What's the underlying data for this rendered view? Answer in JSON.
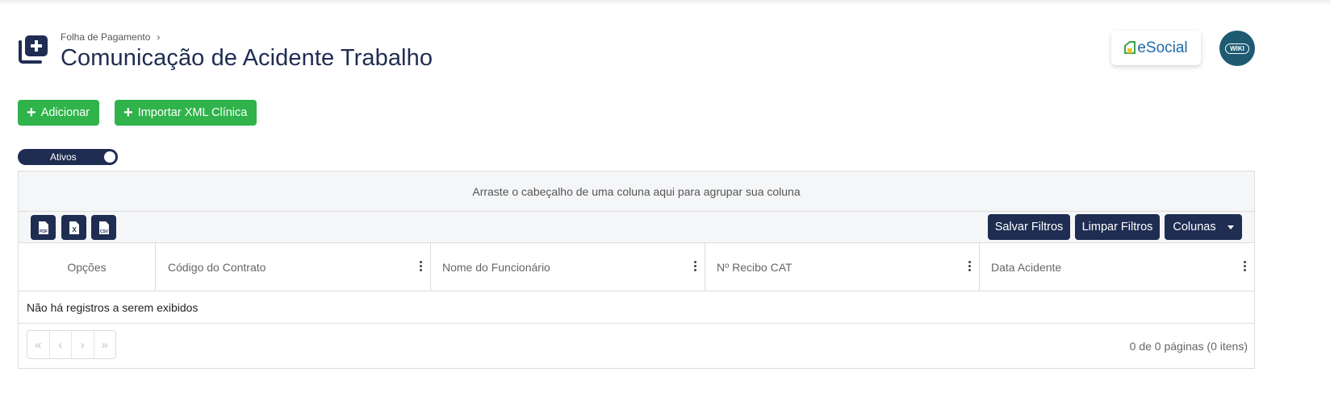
{
  "header": {
    "breadcrumb": "Folha de Pagamento",
    "title": "Comunicação de Acidente Trabalho",
    "page_icon": "add-document-icon"
  },
  "branding": {
    "esocial_label": "eSocial",
    "wiki_label": "WIKI"
  },
  "actions": {
    "add_label": "Adicionar",
    "import_label": "Importar XML Clínica"
  },
  "filter_toggle": {
    "label": "Ativos",
    "checked": true
  },
  "grid": {
    "group_panel_text": "Arraste o cabeçalho de uma coluna aqui para agrupar sua coluna",
    "export_buttons": [
      {
        "label": "PDF",
        "icon": "pdf-icon"
      },
      {
        "label": "X",
        "icon": "excel-icon"
      },
      {
        "label": "CSV",
        "icon": "csv-icon"
      }
    ],
    "toolbar": {
      "save_filters_label": "Salvar Filtros",
      "clear_filters_label": "Limpar Filtros",
      "columns_label": "Colunas"
    },
    "columns": [
      {
        "label": "Opções"
      },
      {
        "label": "Código do Contrato"
      },
      {
        "label": "Nome do Funcionário"
      },
      {
        "label": "Nº Recibo CAT"
      },
      {
        "label": "Data Acidente"
      }
    ],
    "empty_message": "Não há registros a serem exibidos",
    "pager": {
      "first": "«",
      "prev": "‹",
      "next": "›",
      "last": "»",
      "info": "0 de 0 páginas (0 itens)"
    }
  },
  "colors": {
    "primary": "#1f2d52",
    "success": "#2fb34a",
    "wiki": "#1e5a72",
    "esocial": "#1e6aa8"
  }
}
